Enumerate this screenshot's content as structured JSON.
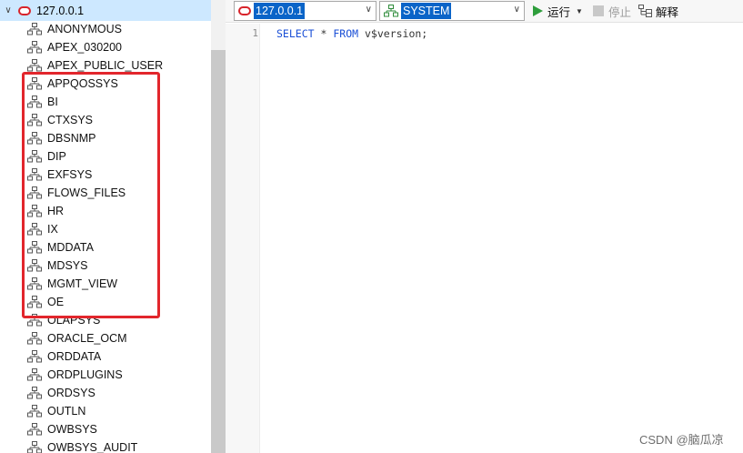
{
  "tree": {
    "root_label": "127.0.0.1",
    "schemas": [
      "ANONYMOUS",
      "APEX_030200",
      "APEX_PUBLIC_USER",
      "APPQOSSYS",
      "BI",
      "CTXSYS",
      "DBSNMP",
      "DIP",
      "EXFSYS",
      "FLOWS_FILES",
      "HR",
      "IX",
      "MDDATA",
      "MDSYS",
      "MGMT_VIEW",
      "OE",
      "OLAPSYS",
      "ORACLE_OCM",
      "ORDDATA",
      "ORDPLUGINS",
      "ORDSYS",
      "OUTLN",
      "OWBSYS",
      "OWBSYS_AUDIT"
    ]
  },
  "toolbar": {
    "connection_value": "127.0.0.1",
    "schema_value": "SYSTEM",
    "run_label": "运行",
    "stop_label": "停止",
    "explain_label": "解释"
  },
  "editor": {
    "line_number": "1",
    "tokens": {
      "select": "SELECT",
      "star": "*",
      "from": "FROM",
      "target": "v$version;"
    }
  },
  "watermark": "CSDN @脑瓜凉",
  "colors": {
    "selection": "#cde8ff",
    "highlight_border": "#e2262c",
    "keyword": "#1a4fd6",
    "run_green": "#2e9e3c",
    "db_icon_red": "#d8232a"
  }
}
